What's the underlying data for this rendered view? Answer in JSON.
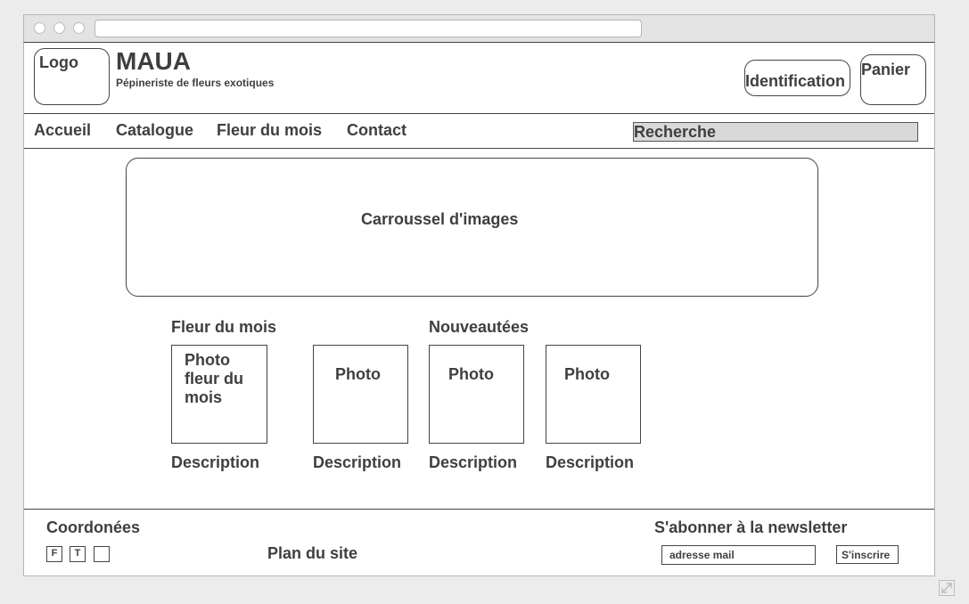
{
  "header": {
    "logo": "Logo",
    "brand": "MAUA",
    "tagline": "Pépineriste de fleurs exotiques",
    "identification": "Identification",
    "cart": "Panier"
  },
  "nav": {
    "items": [
      "Accueil",
      "Catalogue",
      "Fleur du mois",
      "Contact"
    ],
    "search_placeholder": "Recherche"
  },
  "carousel": {
    "label": "Carroussel d'images"
  },
  "products": {
    "flower_of_month_title": "Fleur du mois",
    "new_arrivals_title": "Nouveautées",
    "cards": [
      {
        "photo": "Photo fleur du mois",
        "description": "Description"
      },
      {
        "photo": "Photo",
        "description": "Description"
      },
      {
        "photo": "Photo",
        "description": "Description"
      },
      {
        "photo": "Photo",
        "description": "Description"
      }
    ]
  },
  "footer": {
    "contact_title": "Coordonées",
    "social": [
      "F",
      "T",
      ""
    ],
    "sitemap": "Plan du site",
    "newsletter_title": "S'abonner à la newsletter",
    "email_placeholder": "adresse mail",
    "subscribe": "S'inscrire"
  },
  "icons": {
    "resize": "expand-diagonal-icon",
    "window_controls": "circle-dot-icon"
  },
  "colors": {
    "text": "#3f3f3f",
    "border": "#444444",
    "chrome": "#e3e3e3",
    "search_bg": "#d9d9d9",
    "page_bg": "#ececec"
  }
}
